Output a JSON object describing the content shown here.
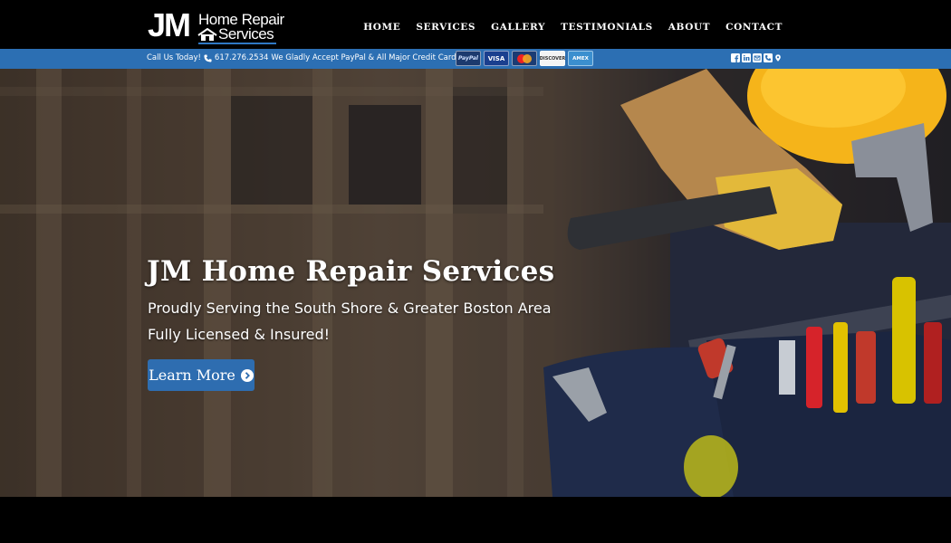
{
  "logo": {
    "initials": "JM",
    "line1": "Home Repair",
    "line2": "Services"
  },
  "nav": {
    "items": [
      "HOME",
      "SERVICES",
      "GALLERY",
      "TESTIMONIALS",
      "ABOUT",
      "CONTACT"
    ]
  },
  "infobar": {
    "call_prefix": "Call Us Today!",
    "phone": "617.276.2534",
    "payment_text": "We Gladly Accept PayPal & All Major Credit Cards.",
    "cards": [
      "PayPal",
      "VISA",
      "MasterCard",
      "DISCOVER",
      "AMEX"
    ],
    "social_icons": [
      "facebook-icon",
      "linkedin-icon",
      "email-icon",
      "phone-icon",
      "map-pin-icon"
    ]
  },
  "hero": {
    "title": "JM Home Repair Services",
    "subtitle1": "Proudly Serving the South Shore & Greater Boston Area",
    "subtitle2": "Fully Licensed & Insured!",
    "button_label": "Learn More"
  },
  "colors": {
    "brand_blue": "#2c6fb3",
    "button_blue": "#2e6db0",
    "header_bg": "#000000",
    "helmet_yellow": "#f5b41a"
  }
}
